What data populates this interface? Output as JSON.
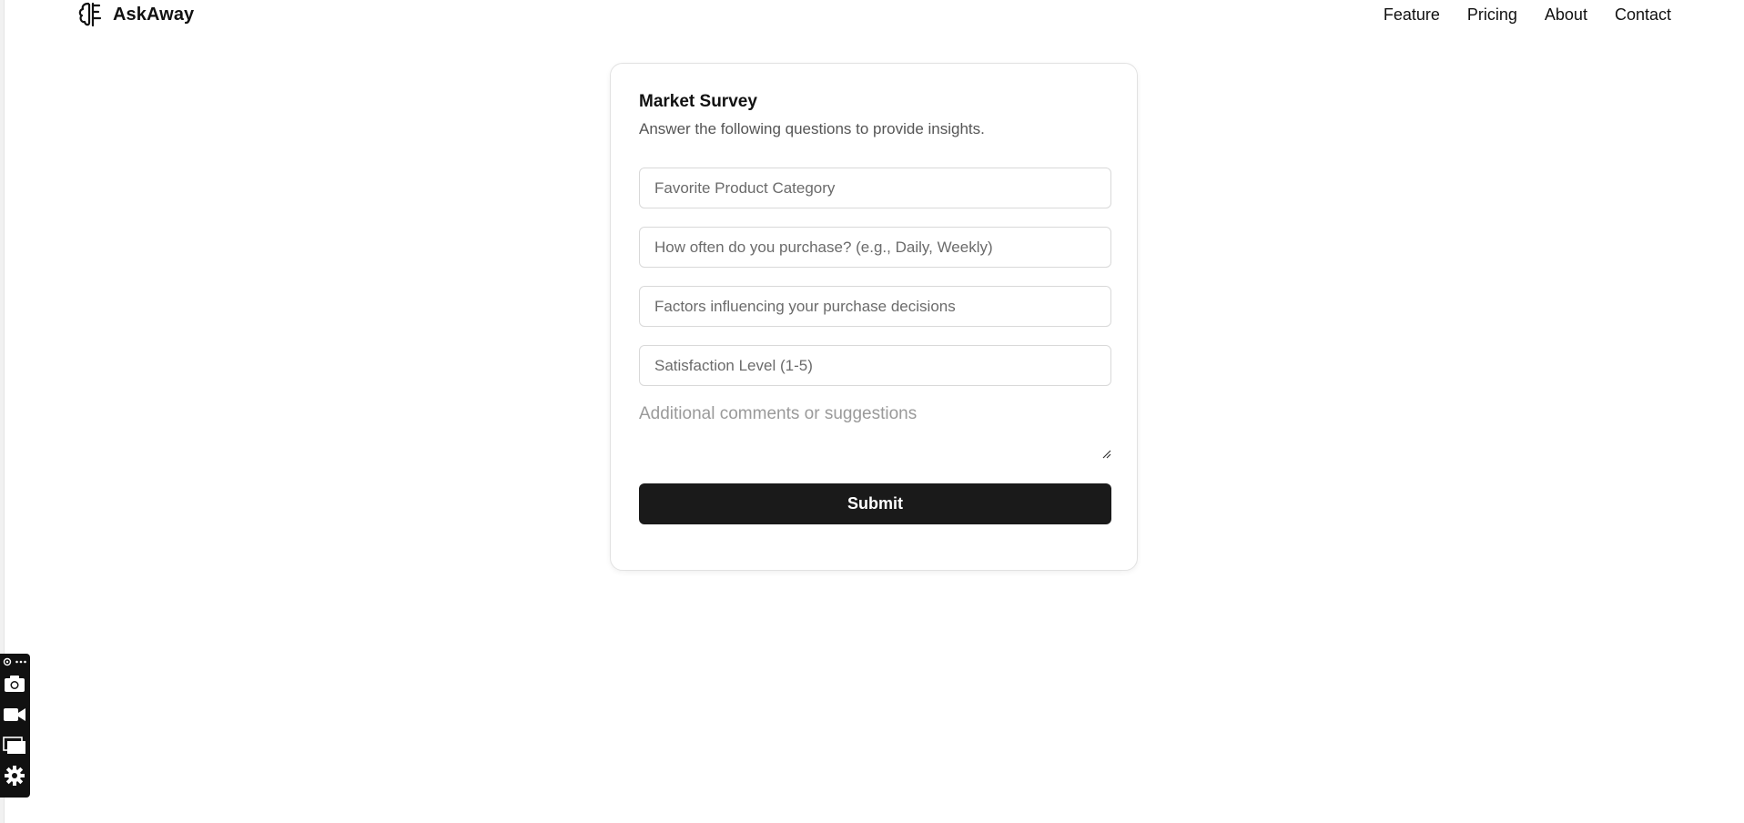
{
  "brand": {
    "name": "AskAway",
    "logo_icon": "brain-icon"
  },
  "nav": {
    "items": [
      {
        "label": "Feature"
      },
      {
        "label": "Pricing"
      },
      {
        "label": "About"
      },
      {
        "label": "Contact"
      }
    ]
  },
  "survey": {
    "title": "Market Survey",
    "subtitle": "Answer the following questions to provide insights.",
    "fields": [
      {
        "placeholder": "Favorite Product Category",
        "value": ""
      },
      {
        "placeholder": "How often do you purchase? (e.g., Daily, Weekly)",
        "value": ""
      },
      {
        "placeholder": "Factors influencing your purchase decisions",
        "value": ""
      },
      {
        "placeholder": "Satisfaction Level (1-5)",
        "value": ""
      }
    ],
    "comments": {
      "placeholder": "Additional comments or suggestions",
      "value": ""
    },
    "submit_label": "Submit",
    "submit_color": "#1a1a1a"
  },
  "toolbar": {
    "icons": [
      "puzzle-icon",
      "more-icon",
      "camera-icon",
      "video-icon",
      "windows-icon",
      "gear-icon"
    ]
  }
}
